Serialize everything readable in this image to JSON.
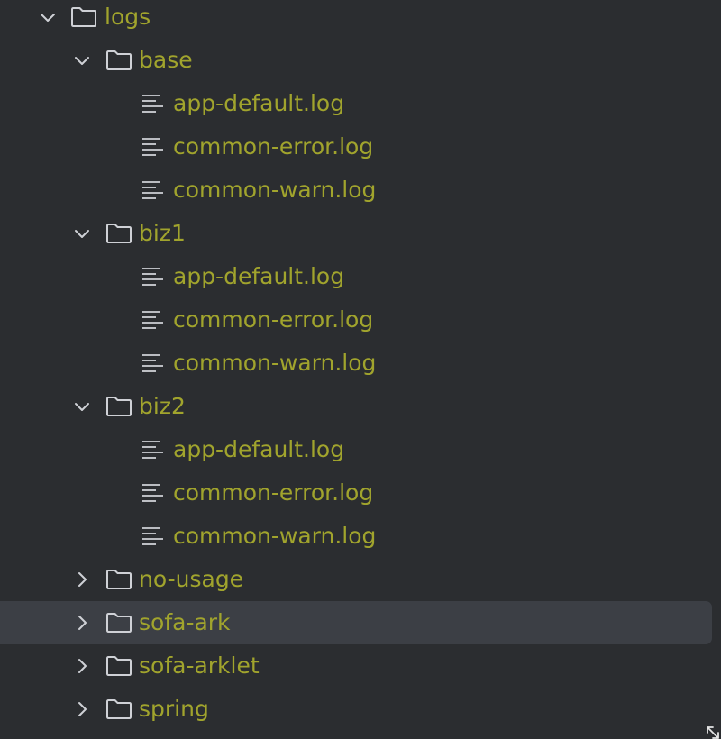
{
  "tree": {
    "root": {
      "name": "logs",
      "icon": "folder-icon",
      "expanded": true
    },
    "folders": [
      {
        "name": "base",
        "expanded": true,
        "files": [
          "app-default.log",
          "common-error.log",
          "common-warn.log"
        ]
      },
      {
        "name": "biz1",
        "expanded": true,
        "files": [
          "app-default.log",
          "common-error.log",
          "common-warn.log"
        ]
      },
      {
        "name": "biz2",
        "expanded": true,
        "files": [
          "app-default.log",
          "common-error.log",
          "common-warn.log"
        ]
      },
      {
        "name": "no-usage",
        "expanded": false,
        "files": []
      },
      {
        "name": "sofa-ark",
        "expanded": false,
        "selected": true,
        "files": []
      },
      {
        "name": "sofa-arklet",
        "expanded": false,
        "files": []
      },
      {
        "name": "spring",
        "expanded": false,
        "files": []
      }
    ]
  },
  "colors": {
    "background": "#2b2d30",
    "selection": "#3c3f45",
    "label": "#a1a42d",
    "icon": "#cfd1d6"
  }
}
